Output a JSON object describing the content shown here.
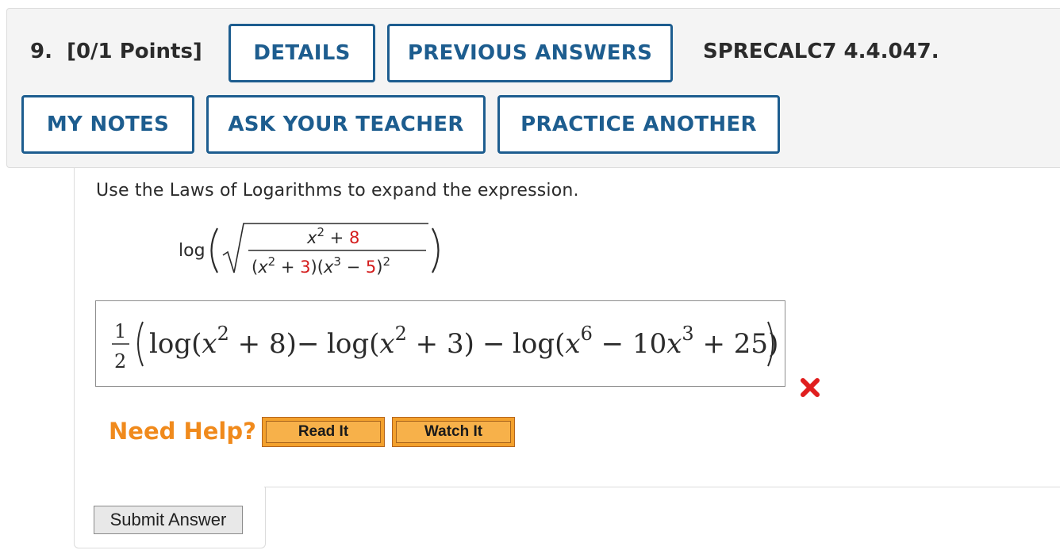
{
  "header": {
    "question_number": "9.",
    "points": "[0/1 Points]",
    "code": "SPRECALC7 4.4.047.",
    "buttons": {
      "details": "DETAILS",
      "previous_answers": "PREVIOUS ANSWERS",
      "my_notes": "MY NOTES",
      "ask_teacher": "ASK YOUR TEACHER",
      "practice_another": "PRACTICE ANOTHER"
    }
  },
  "question": {
    "prompt": "Use the Laws of Logarithms to expand the expression.",
    "expression": {
      "log": "log",
      "num_var": "x",
      "num_exp": "2",
      "num_op": "+",
      "num_const": "8",
      "den_a_var": "x",
      "den_a_exp": "2",
      "den_a_op": "+",
      "den_a_const": "3",
      "den_b_var": "x",
      "den_b_exp": "3",
      "den_b_op": "−",
      "den_b_const": "5",
      "den_b_outer_exp": "2"
    }
  },
  "answer": {
    "frac_num": "1",
    "frac_den": "2",
    "log1": "log",
    "term1_var": "x",
    "term1_exp": "2",
    "term1_rest": " + 8",
    "minus1": "−",
    "log2": "log",
    "term2_var": "x",
    "term2_exp": "2",
    "term2_rest": " + 3",
    "minus2": "−",
    "log3": "log",
    "term3_var": "x",
    "term3_exp": "6",
    "term3_mid": " − 10",
    "term3_var2": "x",
    "term3_exp2": "3",
    "term3_rest": " + 25",
    "status": "incorrect"
  },
  "help": {
    "label": "Need Help?",
    "read_it": "Read It",
    "watch_it": "Watch It"
  },
  "submit_label": "Submit Answer",
  "colors": {
    "accent_blue": "#1d5d8f",
    "help_orange": "#f08a1c",
    "constant_red": "#d41c1c",
    "wrong_red": "#e01e1e"
  }
}
